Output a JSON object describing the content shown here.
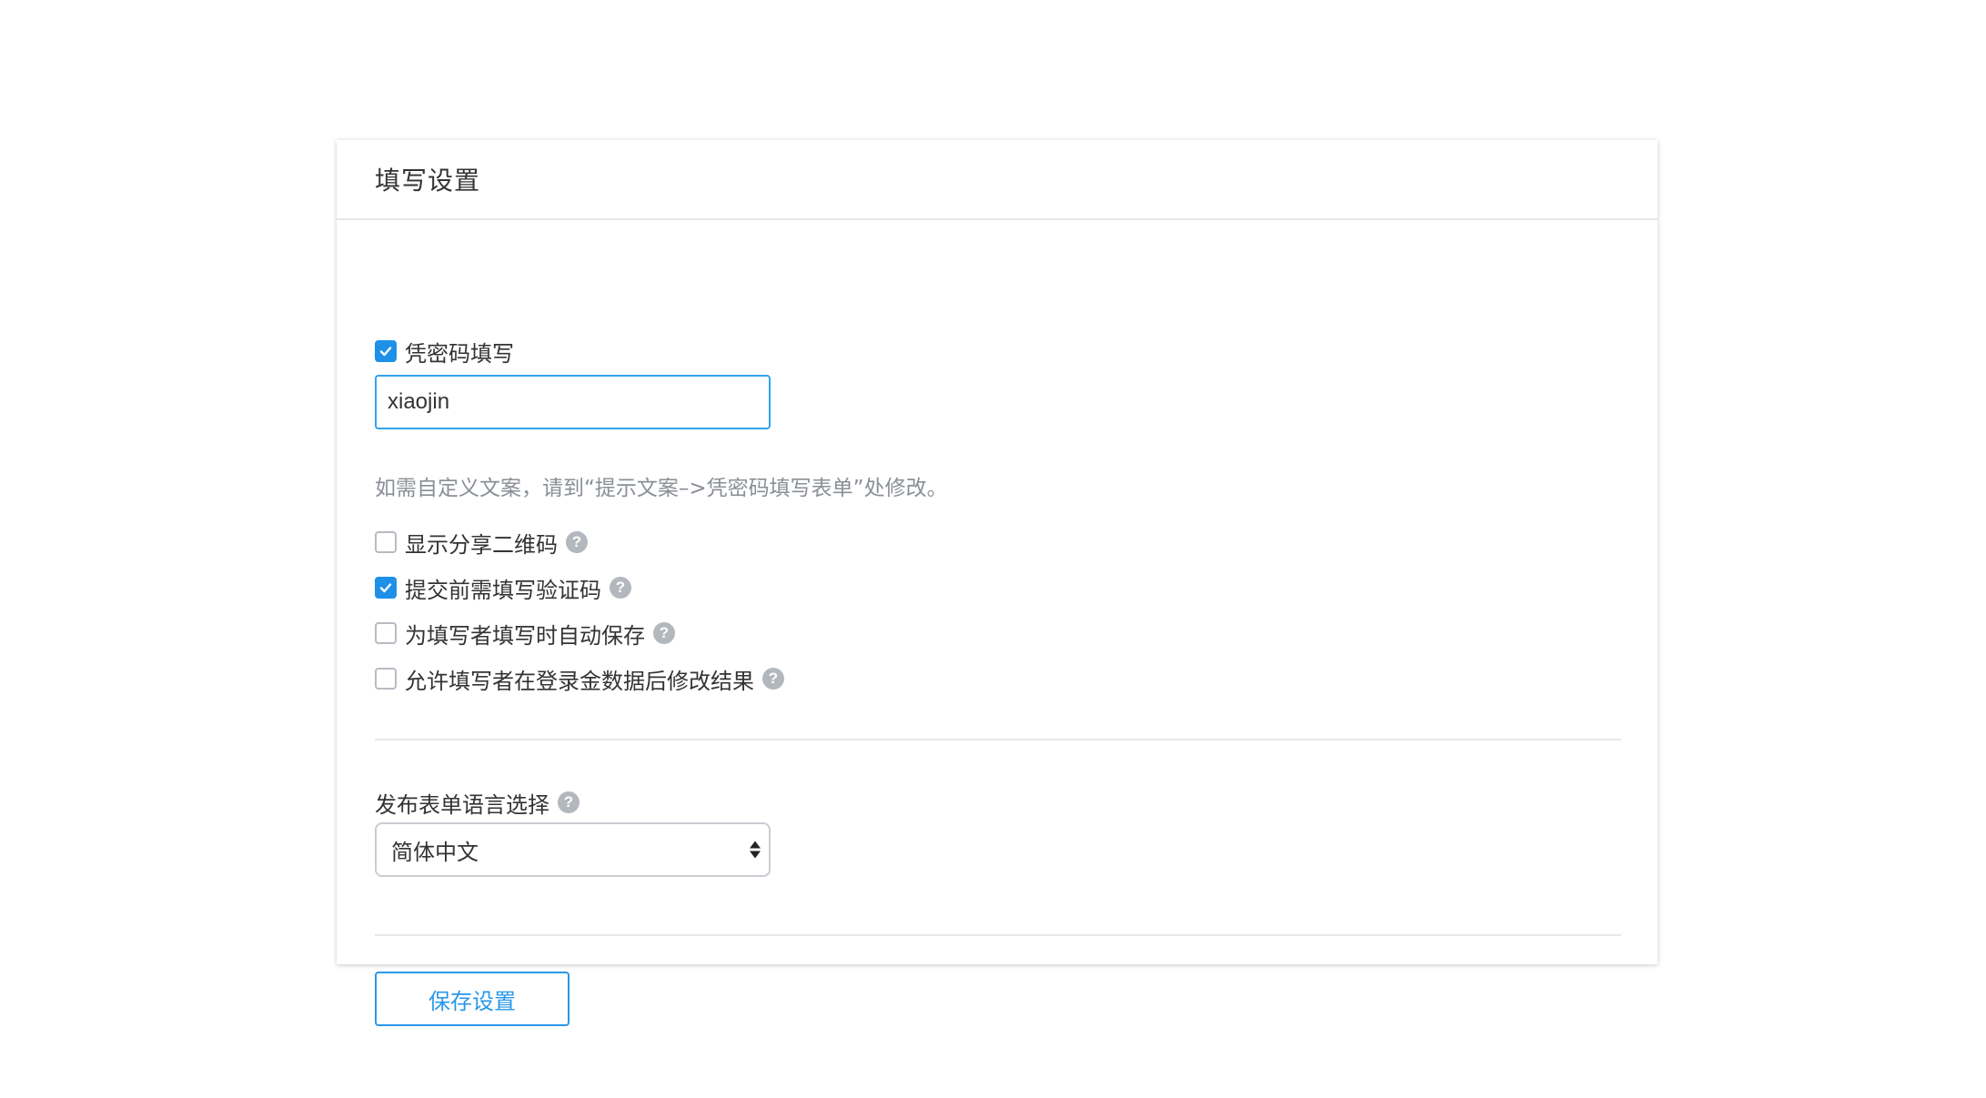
{
  "panel": {
    "title": "填写设置"
  },
  "password": {
    "checkbox_label": "凭密码填写",
    "checked": true,
    "value": "xiaojin",
    "hint": "如需自定义文案，请到“提示文案–>凭密码填写表单”处修改。"
  },
  "options": [
    {
      "label": "显示分享二维码",
      "checked": false,
      "help_icon": "question-circle-icon"
    },
    {
      "label": "提交前需填写验证码",
      "checked": true,
      "help_icon": "question-circle-icon"
    },
    {
      "label": "为填写者填写时自动保存",
      "checked": false,
      "help_icon": "question-circle-icon"
    },
    {
      "label": "允许填写者在登录金数据后修改结果",
      "checked": false,
      "help_icon": "question-circle-icon"
    }
  ],
  "help_glyph": "?",
  "language": {
    "label": "发布表单语言选择",
    "selected": "简体中文"
  },
  "save_button": {
    "label": "保存设置"
  },
  "colors": {
    "accent": "#1e90e8",
    "focus_border": "#33a2ef",
    "help_icon_bg": "#b3b8bf",
    "hint_text": "#8a8f96"
  }
}
